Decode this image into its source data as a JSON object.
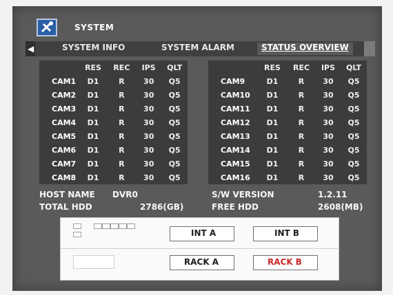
{
  "app": {
    "title": "SYSTEM",
    "icon": "tools-icon"
  },
  "tabs": [
    {
      "label": "SYSTEM INFO",
      "active": false
    },
    {
      "label": "SYSTEM ALARM",
      "active": false
    },
    {
      "label": "STATUS OVERVIEW",
      "active": true
    }
  ],
  "status_table": {
    "headers": [
      "RES",
      "REC",
      "IPS",
      "QLT"
    ],
    "left": [
      {
        "cam": "CAM1",
        "res": "D1",
        "rec": "R",
        "ips": "30",
        "qlt": "Q5"
      },
      {
        "cam": "CAM2",
        "res": "D1",
        "rec": "R",
        "ips": "30",
        "qlt": "Q5"
      },
      {
        "cam": "CAM3",
        "res": "D1",
        "rec": "R",
        "ips": "30",
        "qlt": "Q5"
      },
      {
        "cam": "CAM4",
        "res": "D1",
        "rec": "R",
        "ips": "30",
        "qlt": "Q5"
      },
      {
        "cam": "CAM5",
        "res": "D1",
        "rec": "R",
        "ips": "30",
        "qlt": "Q5"
      },
      {
        "cam": "CAM6",
        "res": "D1",
        "rec": "R",
        "ips": "30",
        "qlt": "Q5"
      },
      {
        "cam": "CAM7",
        "res": "D1",
        "rec": "R",
        "ips": "30",
        "qlt": "Q5"
      },
      {
        "cam": "CAM8",
        "res": "D1",
        "rec": "R",
        "ips": "30",
        "qlt": "Q5"
      }
    ],
    "right": [
      {
        "cam": "CAM9",
        "res": "D1",
        "rec": "R",
        "ips": "30",
        "qlt": "Q5"
      },
      {
        "cam": "CAM10",
        "res": "D1",
        "rec": "R",
        "ips": "30",
        "qlt": "Q5"
      },
      {
        "cam": "CAM11",
        "res": "D1",
        "rec": "R",
        "ips": "30",
        "qlt": "Q5"
      },
      {
        "cam": "CAM12",
        "res": "D1",
        "rec": "R",
        "ips": "30",
        "qlt": "Q5"
      },
      {
        "cam": "CAM13",
        "res": "D1",
        "rec": "R",
        "ips": "30",
        "qlt": "Q5"
      },
      {
        "cam": "CAM14",
        "res": "D1",
        "rec": "R",
        "ips": "30",
        "qlt": "Q5"
      },
      {
        "cam": "CAM15",
        "res": "D1",
        "rec": "R",
        "ips": "30",
        "qlt": "Q5"
      },
      {
        "cam": "CAM16",
        "res": "D1",
        "rec": "R",
        "ips": "30",
        "qlt": "Q5"
      }
    ]
  },
  "system_info": {
    "host_name_label": "HOST NAME",
    "host_name_value": "DVR0",
    "sw_version_label": "S/W VERSION",
    "sw_version_value": "1.2.11",
    "total_hdd_label": "TOTAL HDD",
    "total_hdd_value": "2786(GB)",
    "free_hdd_label": "FREE HDD",
    "free_hdd_value": "2608(MB)"
  },
  "rear_panel": {
    "int_a": "INT A",
    "int_b": "INT B",
    "rack_a": "RACK A",
    "rack_b": "RACK B"
  },
  "colors": {
    "window_bg": "#5a5a5a",
    "tab_bar": "#404040",
    "panel_bg": "#3c3c3c",
    "active_tab_text": "#ffffff",
    "rack_b_text": "#c62828"
  }
}
